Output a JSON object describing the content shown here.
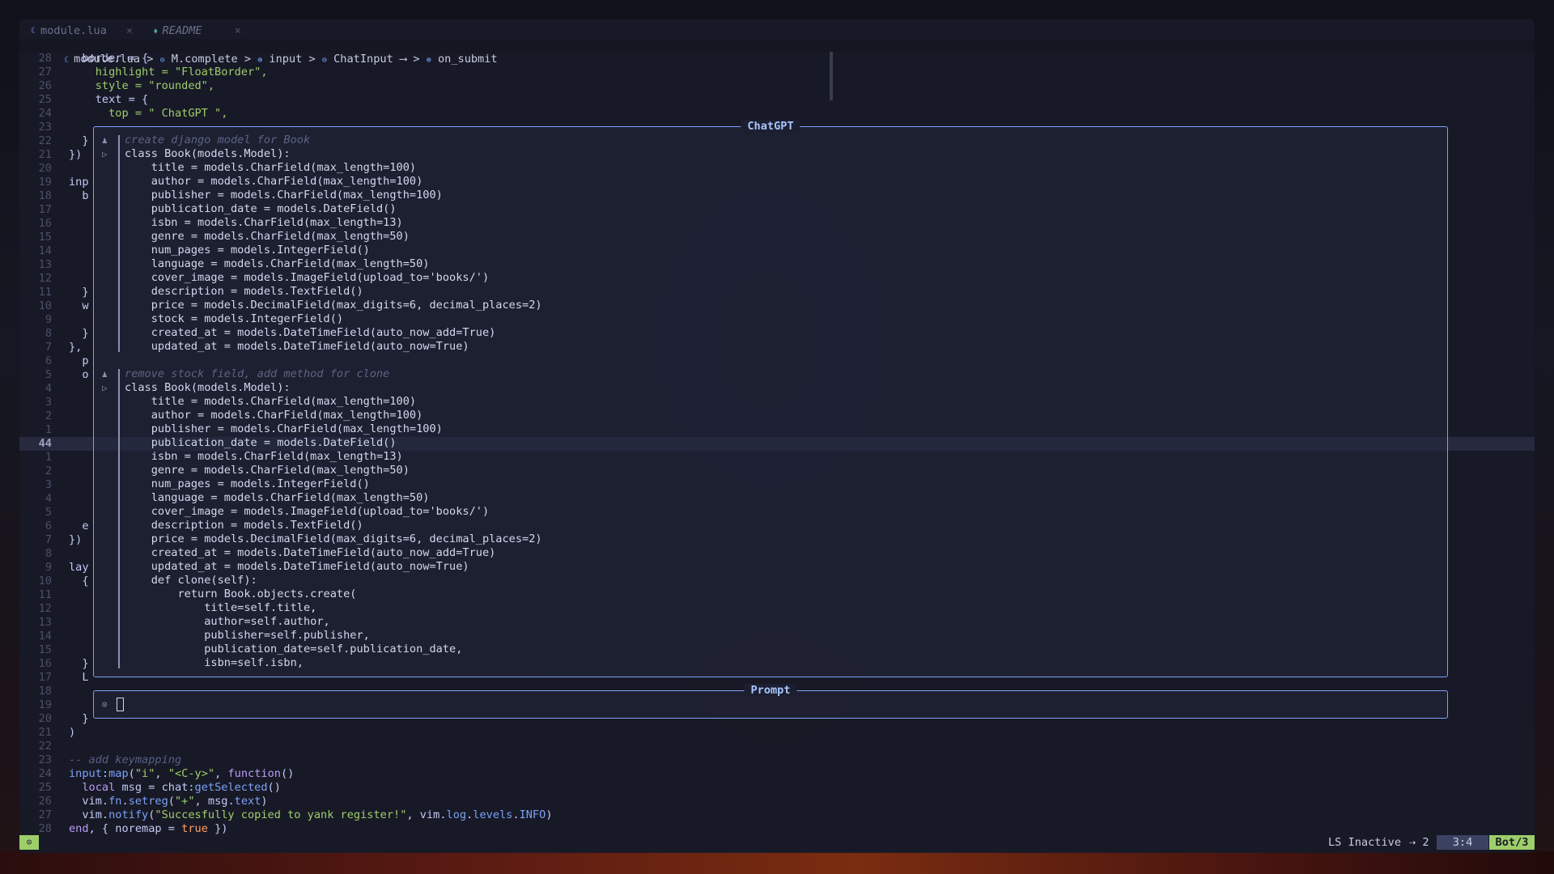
{
  "tabs": [
    {
      "icon": "lua-file-icon",
      "label": "module.lua",
      "close": "×"
    },
    {
      "icon": "markdown-file-icon",
      "label": "README",
      "close": "×"
    }
  ],
  "breadcrumb": {
    "file": "module.lua",
    "sep": ">",
    "items": [
      "M.complete",
      "input",
      "ChatInput",
      "on_submit"
    ],
    "arrow": "⟶"
  },
  "gutter": {
    "numbers": [
      "28",
      "27",
      "26",
      "25",
      "24",
      "23",
      "22",
      "21",
      "20",
      "19",
      "18",
      "17",
      "16",
      "15",
      "14",
      "13",
      "12",
      "11",
      "10",
      "9",
      "8",
      "7",
      "6",
      "5",
      "4",
      "3",
      "2",
      "1",
      "44",
      "1",
      "2",
      "3",
      "4",
      "5",
      "6",
      "7",
      "8",
      "9",
      "10",
      "11",
      "12",
      "13",
      "14",
      "15",
      "16",
      "17",
      "18",
      "19",
      "20",
      "21",
      "22",
      "23",
      "24",
      "25",
      "26",
      "27",
      "28"
    ],
    "current": "44"
  },
  "background_code": {
    "top": [
      "  border = {",
      "    highlight = \"FloatBorder\",",
      "    style = \"rounded\",",
      "    text = {",
      "      top = \" ChatGPT \","
    ],
    "left_fragments": {
      "22": "  }",
      "21": "})",
      "19": "inp",
      "18": "  b",
      "11": "  }",
      "10": "  w",
      "8": "  }",
      "7": "},",
      "5": "  p",
      "4": "  o",
      "6b": "  e",
      "7b": "})",
      "9b": "lay",
      "10b": "  {",
      "16b": "  }",
      "17b": "  L",
      "20b": "  }",
      "21b": ")"
    },
    "bottom": [
      "-- add keymapping",
      "input:map(\"i\", \"<C-y>\", function()",
      "  local msg = chat:getSelected()",
      "  vim.fn.setreg(\"+\", msg.text)",
      "  vim.notify(\"Succesfully copied to yank register!\", vim.log.levels.INFO)",
      "end, { noremap = true })"
    ]
  },
  "chat": {
    "title": "ChatGPT",
    "messages": [
      {
        "question": "create django model for Book",
        "answer": [
          "class Book(models.Model):",
          "    title = models.CharField(max_length=100)",
          "    author = models.CharField(max_length=100)",
          "    publisher = models.CharField(max_length=100)",
          "    publication_date = models.DateField()",
          "    isbn = models.CharField(max_length=13)",
          "    genre = models.CharField(max_length=50)",
          "    num_pages = models.IntegerField()",
          "    language = models.CharField(max_length=50)",
          "    cover_image = models.ImageField(upload_to='books/')",
          "    description = models.TextField()",
          "    price = models.DecimalField(max_digits=6, decimal_places=2)",
          "    stock = models.IntegerField()",
          "    created_at = models.DateTimeField(auto_now_add=True)",
          "    updated_at = models.DateTimeField(auto_now=True)"
        ]
      },
      {
        "question": "remove stock field, add method for clone",
        "answer": [
          "class Book(models.Model):",
          "    title = models.CharField(max_length=100)",
          "    author = models.CharField(max_length=100)",
          "    publisher = models.CharField(max_length=100)",
          "    publication_date = models.DateField()",
          "    isbn = models.CharField(max_length=13)",
          "    genre = models.CharField(max_length=50)",
          "    num_pages = models.IntegerField()",
          "    language = models.CharField(max_length=50)",
          "    cover_image = models.ImageField(upload_to='books/')",
          "    description = models.TextField()",
          "    price = models.DecimalField(max_digits=6, decimal_places=2)",
          "    created_at = models.DateTimeField(auto_now_add=True)",
          "    updated_at = models.DateTimeField(auto_now=True)",
          "    def clone(self):",
          "        return Book.objects.create(",
          "            title=self.title,",
          "            author=self.author,",
          "            publisher=self.publisher,",
          "            publication_date=self.publication_date,",
          "            isbn=self.isbn,"
        ]
      }
    ],
    "question_icon": "♟",
    "answer_icon": "▷"
  },
  "prompt": {
    "title": "Prompt",
    "icon": "⊙",
    "value": ""
  },
  "statusline": {
    "mode_icon": "⊙",
    "ls_status": "LS Inactive",
    "count": "⇢ 2",
    "position": "3:4",
    "percent": "Bot/3"
  },
  "colors": {
    "accent": "#7aa2f7",
    "mode": "#9ece6a",
    "background": "#181a28"
  }
}
